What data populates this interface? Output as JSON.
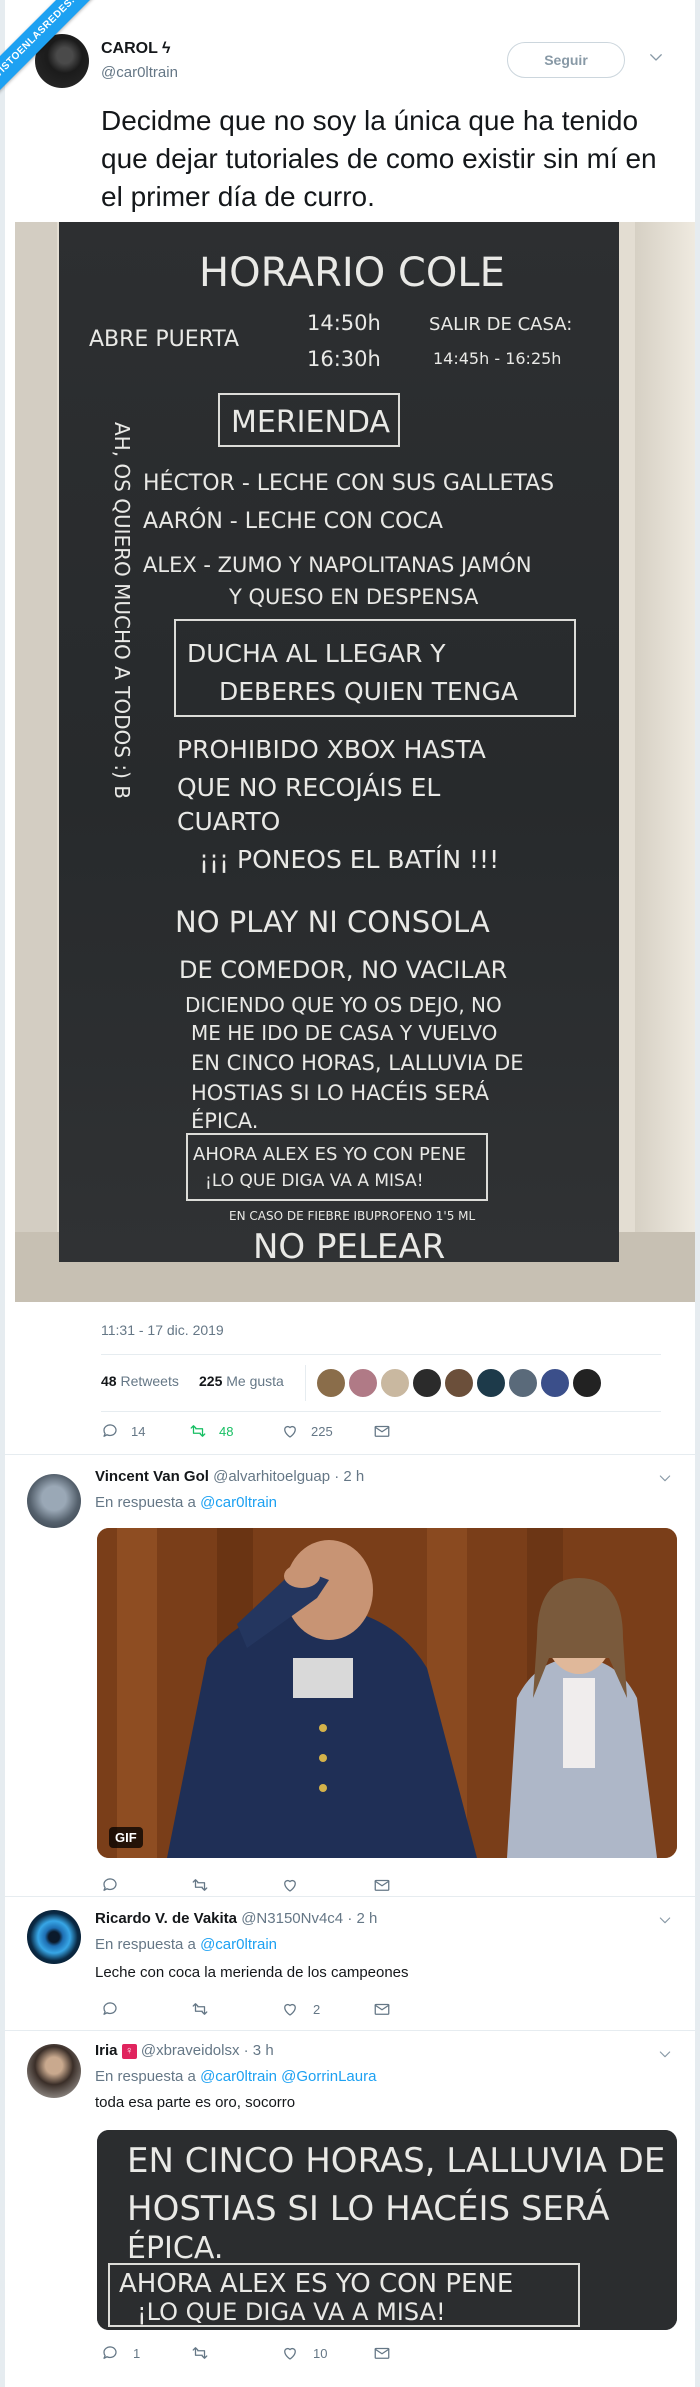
{
  "ribbon": "VISTOENLASREDES.com",
  "tweet": {
    "author_name": "CAROL ϟ",
    "author_handle": "@car0ltrain",
    "follow_label": "Seguir",
    "text": "Decidme que no soy la única que ha tenido que dejar tutoriales de como existir sin mí en el primer día de curro.",
    "timestamp": "11:31 - 17 dic. 2019",
    "retweets_count": "48",
    "retweets_label": "Retweets",
    "likes_count": "225",
    "likes_label": "Me gusta",
    "actions": {
      "reply": "14",
      "retweet": "48",
      "like": "225"
    }
  },
  "chalkboard": {
    "title": "HORARIO COLE",
    "line_abre": "ABRE PUERTA",
    "time_open": "14:50h",
    "time_close": "16:30h",
    "salir": "SALIR DE CASA:",
    "salir_times": "14:45h - 16:25h",
    "merienda_title": "MERIENDA",
    "merienda_1": "HÉCTOR - LECHE CON SUS GALLETAS",
    "merienda_2": "AARÓN - LECHE CON COCA",
    "merienda_3": "ALEX - ZUMO Y NAPOLITANAS JAMÓN",
    "merienda_4": "Y QUESO EN DESPENSA",
    "ducha_1": "DUCHA AL LLEGAR Y",
    "ducha_2": "DEBERES QUIEN TENGA",
    "xbox_1": "PROHIBIDO XBOX HASTA",
    "xbox_2": "QUE NO RECOJÁIS EL",
    "xbox_3": "CUARTO",
    "batin": "¡¡¡ PONEOS EL BATÍN !!!",
    "play_1": "NO PLAY NI CONSOLA",
    "play_2": "DE COMEDOR, NO VACILAR",
    "play_3": "DICIENDO QUE YO OS DEJO, NO",
    "play_4": "ME HE IDO DE CASA Y VUELVO",
    "play_5": "EN CINCO HORAS, LALLUVIA DE",
    "play_6": "HOSTIAS SI LO HACÉIS SERÁ",
    "play_7": "ÉPICA.",
    "alex_1": "AHORA ALEX ES YO CON PENE",
    "alex_2": "¡LO QUE DIGA VA A MISA!",
    "fiebre": "EN CASO DE FIEBRE IBUPROFENO 1'5 ML",
    "pelear": "NO PELEAR",
    "side_note": "AH, OS QUIERO MUCHO A TODOS :) B"
  },
  "replies": [
    {
      "name": "Vincent Van Gol",
      "handle": "@alvarhitoelguap",
      "time": "· 2 h",
      "in_reply_prefix": "En respuesta a",
      "in_reply_to": "@car0ltrain",
      "text": "",
      "media_badge": "GIF",
      "actions": {
        "reply": "",
        "retweet": "",
        "like": ""
      }
    },
    {
      "name": "Ricardo V. de Vakita",
      "handle": "@N3150Nv4c4",
      "time": "· 2 h",
      "in_reply_prefix": "En respuesta a",
      "in_reply_to": "@car0ltrain",
      "text": "Leche con coca la merienda de los campeones",
      "actions": {
        "reply": "",
        "retweet": "",
        "like": "2"
      }
    },
    {
      "name": "Iria",
      "handle": "@xbraveidolsx",
      "time": "· 3 h",
      "in_reply_prefix": "En respuesta a",
      "in_reply_to": "@car0ltrain @GorrinLaura",
      "text": "toda esa parte es oro, socorro",
      "crop_1": "EN CINCO HORAS, LALLUVIA DE",
      "crop_2": "HOSTIAS SI LO HACÉIS SERÁ",
      "crop_3": "ÉPICA.",
      "crop_4": "AHORA ALEX ES YO CON PENE",
      "crop_5": "¡LO QUE DIGA VA A MISA!",
      "actions": {
        "reply": "1",
        "retweet": "",
        "like": "10"
      }
    }
  ],
  "colors": {
    "accent": "#1da1f2",
    "retweet": "#17bf63",
    "muted": "#657786"
  }
}
